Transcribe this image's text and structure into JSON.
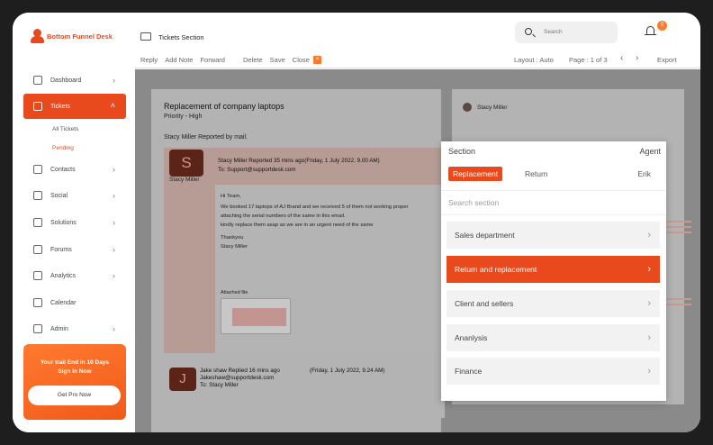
{
  "brand": {
    "name": "Bottom Funnel Desk"
  },
  "sidebar": {
    "items": [
      {
        "label": "Dashboard"
      },
      {
        "label": "Tickets"
      },
      {
        "label": "Contacts"
      },
      {
        "label": "Social"
      },
      {
        "label": "Solutions"
      },
      {
        "label": "Forums"
      },
      {
        "label": "Analytics"
      },
      {
        "label": "Calendar"
      },
      {
        "label": "Admin"
      }
    ],
    "sub_items": [
      "All Tickets",
      "Pending"
    ],
    "promo": {
      "text": "Your trail End in 10 Days Sign In Now",
      "button": "Get Pro Now"
    }
  },
  "topbar": {
    "section_title": "Tickets Section",
    "search_placeholder": "Search",
    "notification_count": "0",
    "actions": [
      "Reply",
      "Add Note",
      "Forward",
      "Delete",
      "Save",
      "Close"
    ],
    "close_badge": "×",
    "layout": "Layout : Auto",
    "page": "Page : 1 of 3",
    "export": "Export"
  },
  "ticket": {
    "title": "Replacement of company laptops",
    "priority": "Priority  - High",
    "reported_by": "Stacy Miller Reported by mail.",
    "message1": {
      "initial": "S",
      "name": "Stacy Miller",
      "header": "Stacy Miller Reported 35 mins ago(Friday, 1 July 2022, 9.00 AM)",
      "to": "To: Support@supportdesk.com",
      "body": [
        "Hi Team,",
        "We booked 17 laptops of AJ Brand and we received 5 of them not working proper",
        "attaching the serial numbers of the same in this email.",
        "kindly replace them asap as we are in an urgent need of the same",
        "Thankyou",
        "Stacy Miller"
      ],
      "attached_label": "Attached file"
    },
    "message2": {
      "initial": "J",
      "header": "Jake shaw Replied 16 mins ago",
      "date": "(Friday, 1 July 2022, 9.24 AM)",
      "from": "Jakeshaw@supportdesk.com",
      "to": "To: Stacy Miller"
    }
  },
  "right_panel": {
    "name": "Stacy Miller"
  },
  "dropdown": {
    "header_left": "Section",
    "header_right": "Agent",
    "tabs": [
      "Replacement",
      "Return"
    ],
    "agent": "Erik",
    "search_placeholder": "Search section",
    "options": [
      "Sales department",
      "Return and replacement",
      "Client and sellers",
      "Ananlysis",
      "Finance"
    ],
    "selected": "Return and replacement"
  },
  "colors": {
    "accent": "#e8491d"
  }
}
